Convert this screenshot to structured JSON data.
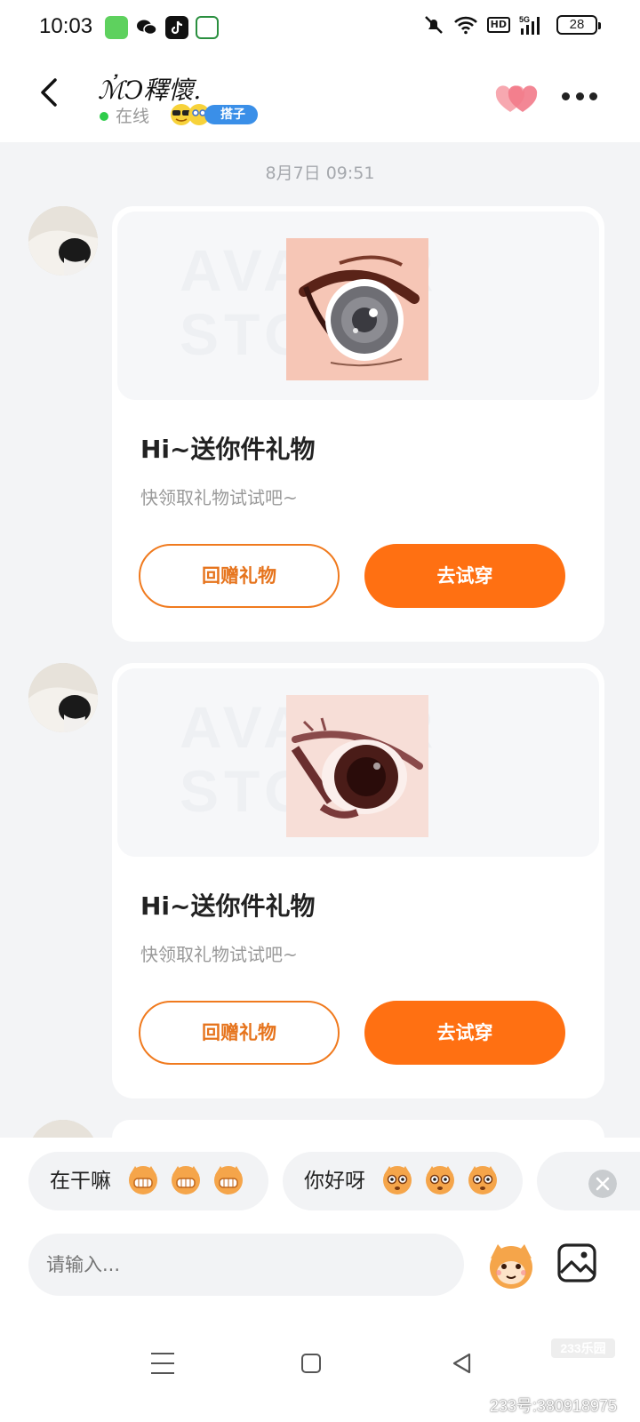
{
  "status_bar": {
    "time": "10:03",
    "network": "5G",
    "hd": "HD",
    "battery": "28"
  },
  "header": {
    "contact_name": "ℳ҆Ↄ釋懷.",
    "online_status": "在线",
    "partner_badge": "搭子"
  },
  "chat": {
    "timestamp": "8月7日 09:51",
    "messages": [
      {
        "watermark": "AVATAR STORE",
        "title": "Hi~送你件礼物",
        "subtitle": "快领取礼物试试吧~",
        "return_gift_label": "回赠礼物",
        "try_on_label": "去试穿"
      },
      {
        "watermark": "AVATAR STORE",
        "title": "Hi~送你件礼物",
        "subtitle": "快领取礼物试试吧~",
        "return_gift_label": "回赠礼物",
        "try_on_label": "去试穿"
      }
    ]
  },
  "quick_replies": [
    {
      "text": "在干嘛"
    },
    {
      "text": "你好呀"
    }
  ],
  "input": {
    "placeholder": "请输入..."
  },
  "watermark_footer": {
    "logo": "233乐园",
    "id_text": "233号:380918975"
  },
  "colors": {
    "accent": "#ff7012",
    "online": "#2ecc4a",
    "badge": "#3a8fe8"
  },
  "icons": [
    "back-arrow-icon",
    "hearts-icon",
    "more-icon",
    "emoji-icon",
    "image-icon",
    "close-icon"
  ]
}
